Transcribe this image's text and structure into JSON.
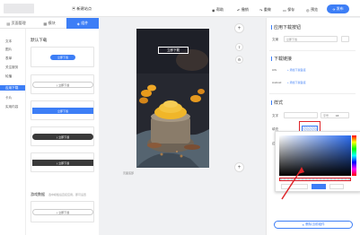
{
  "topbar": {
    "page_name": "新建站点",
    "actions": [
      {
        "label": "帮助",
        "icon": "help-icon"
      },
      {
        "label": "撤销",
        "icon": "undo-icon"
      },
      {
        "label": "重做",
        "icon": "redo-icon"
      },
      {
        "label": "保存",
        "icon": "save-icon"
      },
      {
        "label": "预览",
        "icon": "eye-icon"
      }
    ],
    "publish_label": "发布"
  },
  "left_tabs": [
    {
      "label": "页面管理",
      "icon": "page-icon"
    },
    {
      "label": "模块",
      "icon": "module-icon"
    },
    {
      "label": "组件",
      "icon": "component-icon",
      "active": true
    }
  ],
  "categories": [
    "文本",
    "图片",
    "表单",
    "关注服务",
    "轮播",
    "应用下载",
    "卡片",
    "实用内容"
  ],
  "active_category": "应用下载",
  "components": {
    "section_title": "默认下载",
    "button_label": "立即下载",
    "download_label": "立即下载",
    "section2_title": "游戏数据",
    "section2_desc": "选中模板后直接应用，即可设置"
  },
  "canvas": {
    "overlay_button": "立即下载",
    "footer_tag": "页面底部"
  },
  "right_panel": {
    "title_app": "应用下载按钮",
    "field_text_label": "文案",
    "field_text_value": "立即下载",
    "title_link": "下载链接",
    "ios_label": "iOS",
    "ios_link": "+ 添加下载链接",
    "android_label": "Android",
    "android_link": "+ 添加下载链接",
    "title_style": "样式",
    "font_label": "文字",
    "font_size_label": "字号",
    "font_size_value": "16",
    "fill_label": "填充",
    "border_label": "边框",
    "fill_color": "#c5d6f5",
    "footer_button": "删除当前组件"
  },
  "colors": {
    "accent": "#3d7ef6",
    "highlight_box": "#e0262b"
  }
}
